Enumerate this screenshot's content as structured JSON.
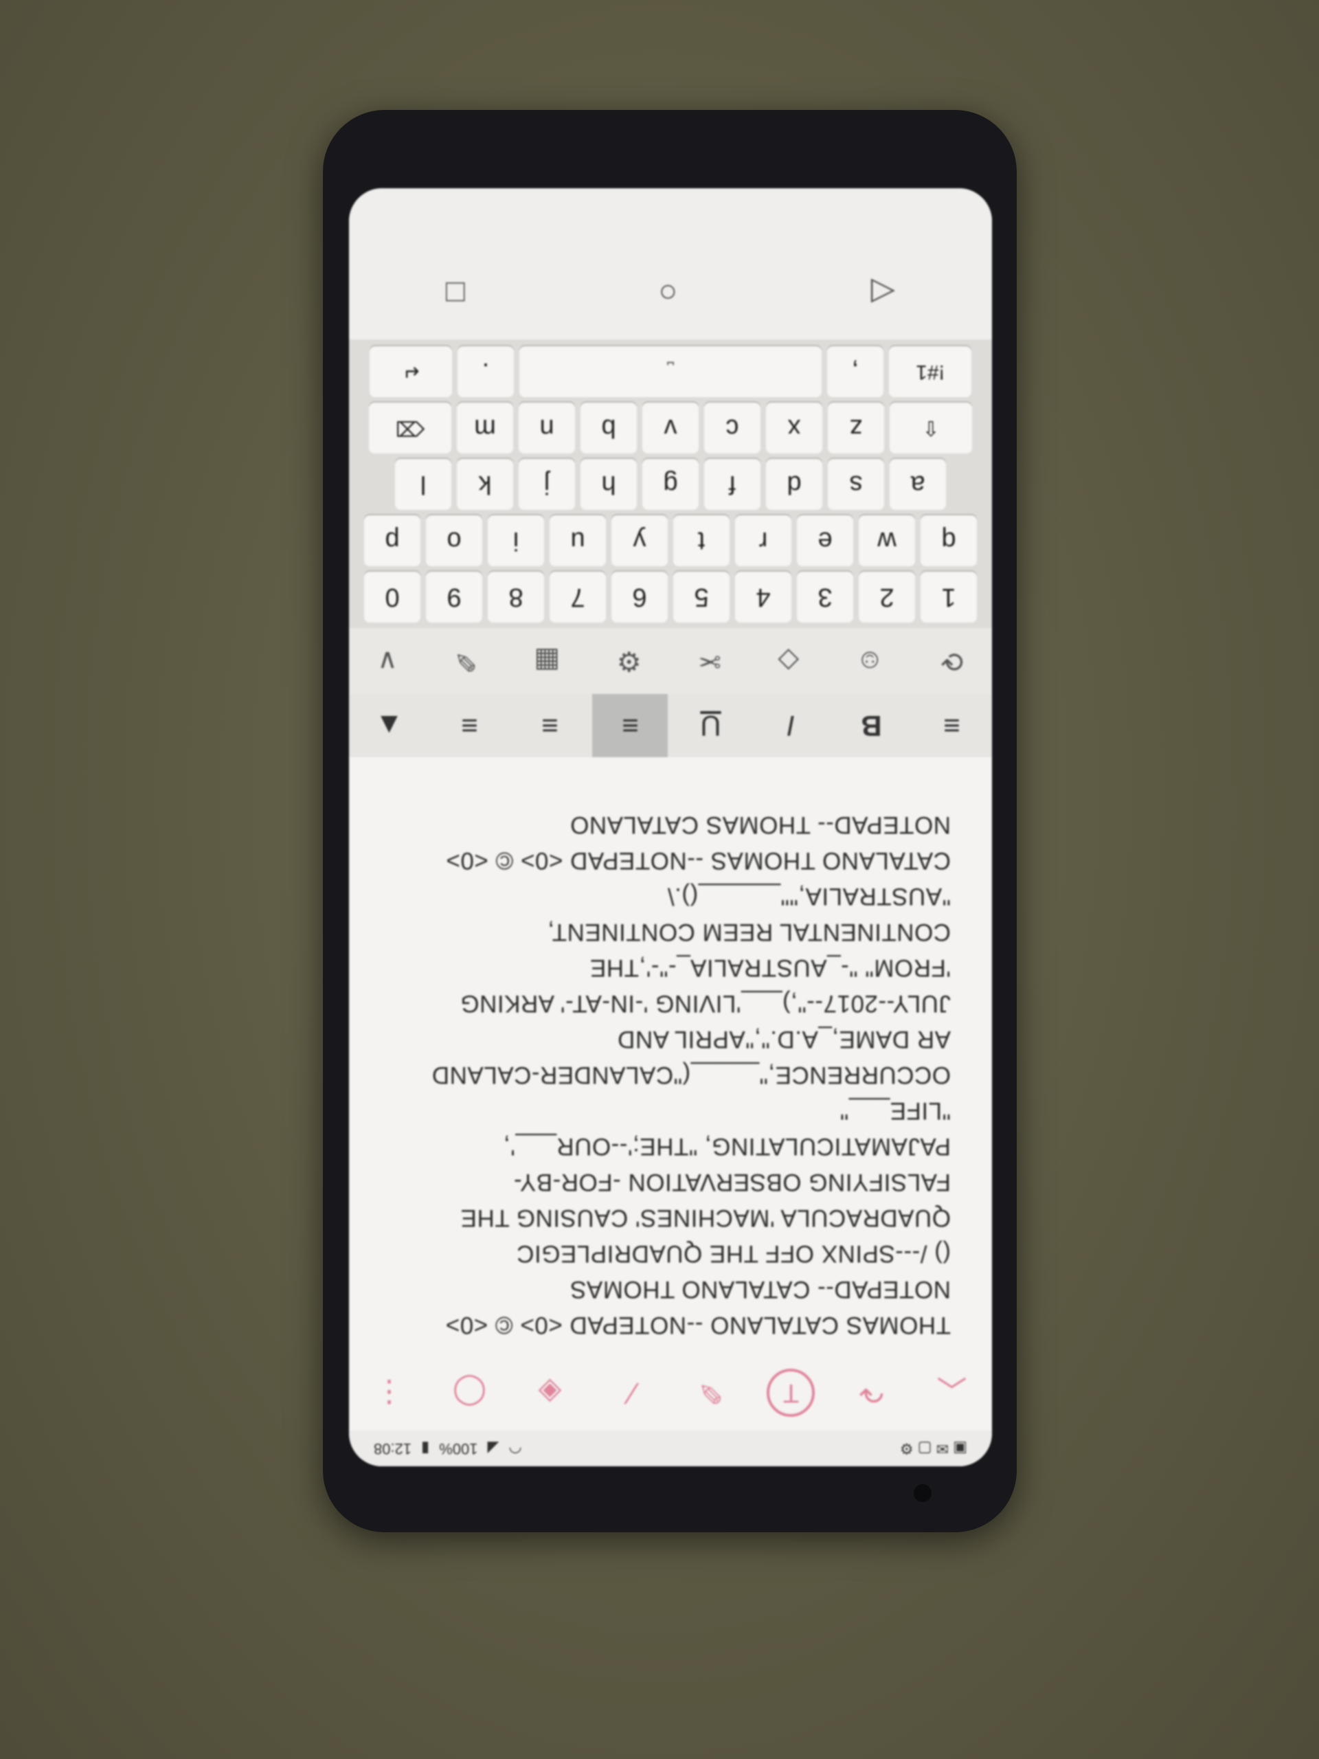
{
  "status_bar": {
    "left_icons": "▣ ✉ ▢ ⚙",
    "battery": "100%",
    "time": "12:08"
  },
  "pen_toolbar": {
    "icons": [
      "chevron-up-icon",
      "redo-icon",
      "text-icon",
      "pen-icon",
      "highlighter-icon",
      "eraser-icon",
      "lasso-icon",
      "more-icon"
    ]
  },
  "note": {
    "lines": [
      "THOMAS CATALANO --NOTEPAD <0> © <0>",
      "NOTEPAD-- CATALANO THOMAS",
      "() /---SPINX OFF THE QUADRIPLEGIC",
      "QUADRACULA 'MACHINES' CAUSING THE",
      "FALSIFYING OBSERVATION -FOR-BY-",
      "PAJAMATICULATING, \"THE;'--OUR___',",
      "\"LIFE___\"",
      "OCCURRENCE,\"_____(\"CALANDER-CALAND",
      "AR DAME,_A.D.\",\"APRIL AND",
      "JULY--2017--\",)___'LIVING '-IN-AT-' ARKING",
      "'FROM\" \"-_AUSTRALIA_-\"-',THE",
      "CONTINENTAL REEM CONTINENT,",
      "\"AUSTRALIA,\"\"______().\\",
      "CATALANO THOMAS --NOTEPAD <0> © <0>",
      "NOTEPAD-- THOMAS CATALANO"
    ]
  },
  "format_bar": {
    "items": [
      "≡",
      "B",
      "I",
      "U",
      "≡",
      "≡",
      "≡",
      "▲"
    ]
  },
  "tools_bar": {
    "items": [
      "⟳",
      "☺",
      "◇",
      "✂",
      "⚙",
      "▦",
      "✎",
      "∨"
    ]
  },
  "keyboard": {
    "numbers": [
      "1",
      "2",
      "3",
      "4",
      "5",
      "6",
      "7",
      "8",
      "9",
      "0"
    ],
    "row1": [
      "q",
      "w",
      "e",
      "r",
      "t",
      "y",
      "u",
      "i",
      "o",
      "p"
    ],
    "row2": [
      "a",
      "s",
      "d",
      "f",
      "g",
      "h",
      "j",
      "k",
      "l"
    ],
    "row3": [
      "z",
      "x",
      "c",
      "v",
      "b",
      "n",
      "m"
    ],
    "shift": "⇧",
    "backspace": "⌫",
    "sym": "!#1",
    "comma": ",",
    "space": "⎵",
    "period": ".",
    "enter": "↵"
  },
  "navbar": {
    "back": "◁",
    "home": "○",
    "recents": "□"
  }
}
